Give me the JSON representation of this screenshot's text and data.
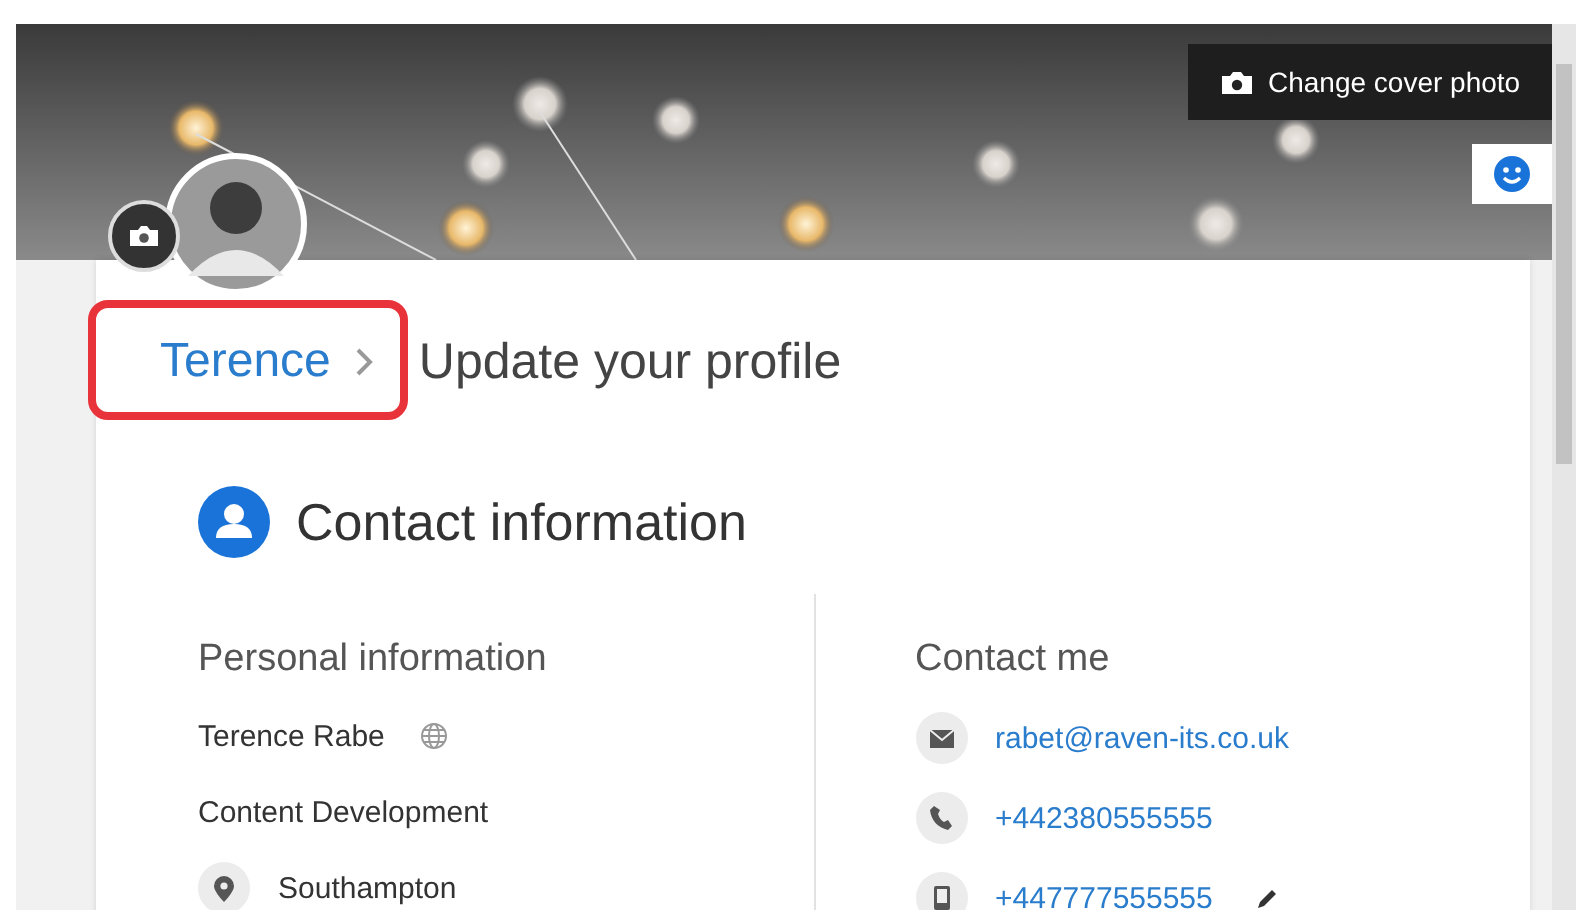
{
  "cover": {
    "kind": "picture",
    "button": "Change cover photo"
  },
  "profile": {
    "name": "Terence",
    "title": "Update your profile",
    "highlighted": true
  },
  "section": {
    "title": "Contact information"
  },
  "personal": {
    "heading": "Personal information",
    "items": [
      {
        "kind": "name",
        "text": "Terence Rabe"
      },
      {
        "kind": "plain",
        "text": "Content Development"
      },
      {
        "kind": "location",
        "text": "Southampton"
      }
    ]
  },
  "contact": {
    "heading": "Contact me",
    "items": [
      {
        "kind": "email",
        "text": "rabet@raven-its.co.uk",
        "editable": false
      },
      {
        "kind": "phone",
        "text": "+442380555555",
        "editable": false
      },
      {
        "kind": "mobile",
        "text": "+447777555555",
        "editable": true
      }
    ]
  }
}
